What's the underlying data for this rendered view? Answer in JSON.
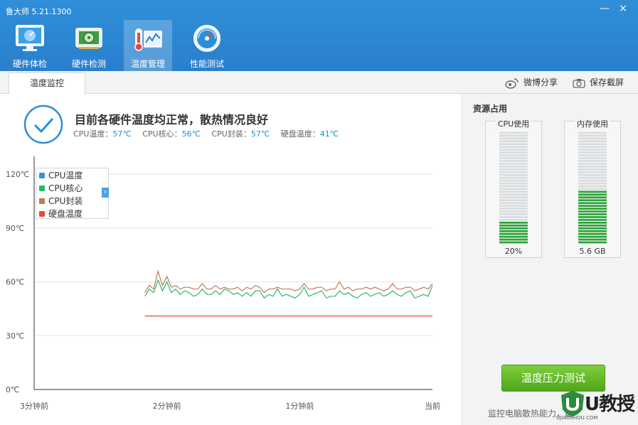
{
  "window": {
    "title": "鲁大师 5.21.1300",
    "minimize": "—",
    "close": "×"
  },
  "nav": [
    {
      "label": "硬件体检",
      "icon": "monitor-icon"
    },
    {
      "label": "硬件检测",
      "icon": "graphics-card-icon"
    },
    {
      "label": "温度管理",
      "icon": "thermometer-icon"
    },
    {
      "label": "性能测试",
      "icon": "speedometer-icon"
    }
  ],
  "subbar": {
    "tab": "温度监控",
    "share": "微博分享",
    "screenshot": "保存截屏"
  },
  "status": {
    "title": "目前各硬件温度均正常，散热情况良好",
    "readings": [
      {
        "label": "CPU温度：",
        "value": "57℃"
      },
      {
        "label": "CPU核心：",
        "value": "56℃"
      },
      {
        "label": "CPU封装：",
        "value": "57℃"
      },
      {
        "label": "硬盘温度：",
        "value": "41℃"
      }
    ]
  },
  "colors": {
    "cpu_temp": "#3a8ee6",
    "cpu_core": "#2bb673",
    "cpu_package": "#c07b55",
    "disk_temp": "#e8483c",
    "accent": "#2a7fcd"
  },
  "chart_data": {
    "type": "line",
    "title": "",
    "ylabel": "",
    "ylim": [
      0,
      130
    ],
    "yticks": [
      "0℃",
      "30℃",
      "60℃",
      "90℃",
      "120℃"
    ],
    "ytick_values": [
      0,
      30,
      60,
      90,
      120
    ],
    "xlabels": [
      "3分钟前",
      "2分钟前",
      "1分钟前",
      "当前"
    ],
    "xlim": [
      -180,
      0
    ],
    "grid": true,
    "legend": "top-left",
    "series": [
      {
        "name": "CPU温度",
        "color": "#3a8ee6"
      },
      {
        "name": "CPU核心",
        "color": "#2bb673"
      },
      {
        "name": "CPU封装",
        "color": "#c07b55"
      },
      {
        "name": "硬盘温度",
        "color": "#e8483c"
      }
    ],
    "x": [
      -130,
      -128,
      -126,
      -124,
      -122,
      -120,
      -118,
      -116,
      -114,
      -112,
      -110,
      -108,
      -106,
      -104,
      -102,
      -100,
      -98,
      -96,
      -94,
      -92,
      -90,
      -88,
      -86,
      -84,
      -82,
      -80,
      -78,
      -76,
      -74,
      -72,
      -70,
      -68,
      -66,
      -64,
      -62,
      -60,
      -58,
      -56,
      -54,
      -52,
      -50,
      -48,
      -46,
      -44,
      -42,
      -40,
      -38,
      -36,
      -34,
      -32,
      -30,
      -28,
      -26,
      -24,
      -22,
      -20,
      -18,
      -16,
      -14,
      -12,
      -10,
      -8,
      -6,
      -4,
      -2,
      0
    ],
    "cpu_core": [
      52,
      56,
      54,
      61,
      55,
      60,
      54,
      56,
      53,
      55,
      54,
      52,
      53,
      56,
      53,
      53,
      55,
      53,
      56,
      55,
      53,
      54,
      52,
      54,
      52,
      55,
      55,
      51,
      53,
      52,
      56,
      52,
      53,
      52,
      51,
      53,
      57,
      52,
      53,
      54,
      55,
      51,
      52,
      52,
      55,
      53,
      54,
      52,
      51,
      53,
      54,
      52,
      53,
      54,
      52,
      53,
      55,
      53,
      52,
      54,
      55,
      51,
      52,
      53,
      52,
      58
    ],
    "cpu_package": [
      54,
      58,
      56,
      66,
      58,
      63,
      57,
      58,
      56,
      57,
      57,
      56,
      56,
      59,
      56,
      56,
      58,
      56,
      57,
      56,
      56,
      57,
      55,
      57,
      56,
      58,
      57,
      54,
      56,
      56,
      57,
      56,
      56,
      56,
      55,
      56,
      59,
      56,
      56,
      57,
      57,
      55,
      56,
      56,
      60,
      56,
      57,
      55,
      56,
      56,
      57,
      56,
      57,
      56,
      55,
      56,
      59,
      56,
      56,
      57,
      57,
      55,
      56,
      57,
      56,
      59
    ],
    "disk_temp": [
      41,
      41,
      41,
      41,
      41,
      41,
      41,
      41,
      41,
      41,
      41,
      41,
      41,
      41,
      41,
      41,
      41,
      41,
      41,
      41,
      41,
      41,
      41,
      41,
      41,
      41,
      41,
      41,
      41,
      41,
      41,
      41,
      41,
      41,
      41,
      41,
      41,
      41,
      41,
      41,
      41,
      41,
      41,
      41,
      41,
      41,
      41,
      41,
      41,
      41,
      41,
      41,
      41,
      41,
      41,
      41,
      41,
      41,
      41,
      41,
      41,
      41,
      41,
      41,
      41,
      41
    ]
  },
  "resources": {
    "title": "资源占用",
    "cpu": {
      "label": "CPU使用",
      "value": "20%",
      "fraction": 0.2
    },
    "memory": {
      "label": "内存使用",
      "value": "5.6 GB",
      "fraction": 0.47
    }
  },
  "stress_button": "温度压力测试",
  "footer": "监控电脑散热能力，能",
  "watermark": {
    "text": "U教授",
    "sub": "UJIAOSHOU.COM"
  }
}
